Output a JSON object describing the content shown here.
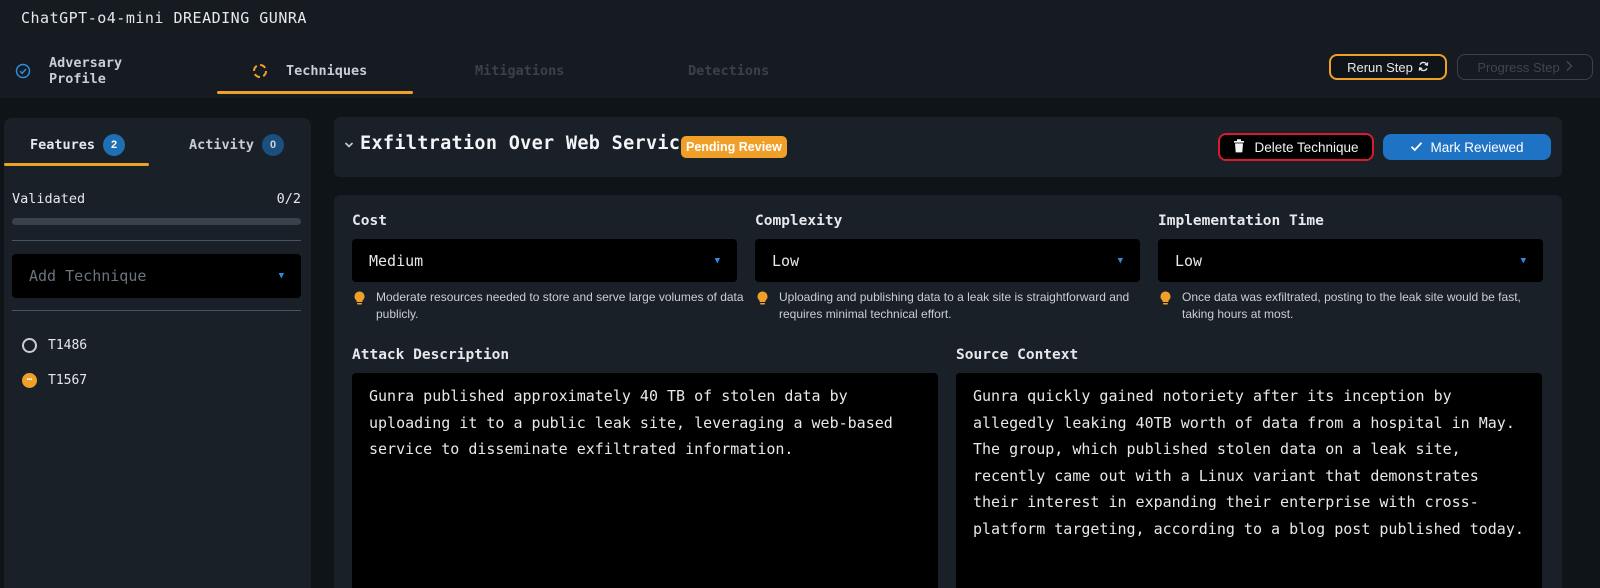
{
  "app": {
    "title": "ChatGPT-o4-mini DREADING GUNRA"
  },
  "steps": [
    {
      "label": "Adversary Profile",
      "state": "complete"
    },
    {
      "label": "Techniques",
      "state": "active"
    },
    {
      "label": "Mitigations",
      "state": "disabled"
    },
    {
      "label": "Detections",
      "state": "disabled"
    }
  ],
  "actions": {
    "rerun_label": "Rerun Step",
    "progress_label": "Progress Step"
  },
  "sidebar": {
    "tabs": [
      {
        "label": "Features",
        "count": "2"
      },
      {
        "label": "Activity",
        "count": "0"
      }
    ],
    "validated_label": "Validated",
    "validated_value": "0/2",
    "validated_fraction": 0,
    "add_technique_placeholder": "Add Technique",
    "techniques": [
      {
        "id": "T1486",
        "status": "not-started"
      },
      {
        "id": "T1567",
        "status": "pending"
      }
    ]
  },
  "technique": {
    "title": "Exfiltration Over Web Service",
    "status_badge": "Pending Review",
    "delete_label": "Delete Technique",
    "reviewed_label": "Mark Reviewed",
    "fields": [
      {
        "label": "Cost",
        "value": "Medium",
        "hint": "Moderate resources needed to store and serve large volumes of data publicly."
      },
      {
        "label": "Complexity",
        "value": "Low",
        "hint": "Uploading and publishing data to a leak site is straightforward and requires minimal technical effort."
      },
      {
        "label": "Implementation Time",
        "value": "Low",
        "hint": "Once data was exfiltrated, posting to the leak site would be fast, taking hours at most."
      }
    ],
    "attack_description_label": "Attack Description",
    "attack_description": "Gunra published approximately 40 TB of stolen data by uploading it to a public leak site, leveraging a web-based service to disseminate exfiltrated information.",
    "source_context_label": "Source Context",
    "source_context": "Gunra quickly gained notoriety after its inception by allegedly leaking 40TB worth of data from a hospital in May. The group, which published stolen data on a leak site, recently came out with a Linux variant that demonstrates their interest in expanding their enterprise with cross-platform targeting, according to a blog post published today."
  },
  "colors": {
    "accent": "#f0a028",
    "primary": "#1f73c4",
    "danger": "#d81b2c",
    "background": "#0f1419",
    "panel": "#1a2028"
  }
}
